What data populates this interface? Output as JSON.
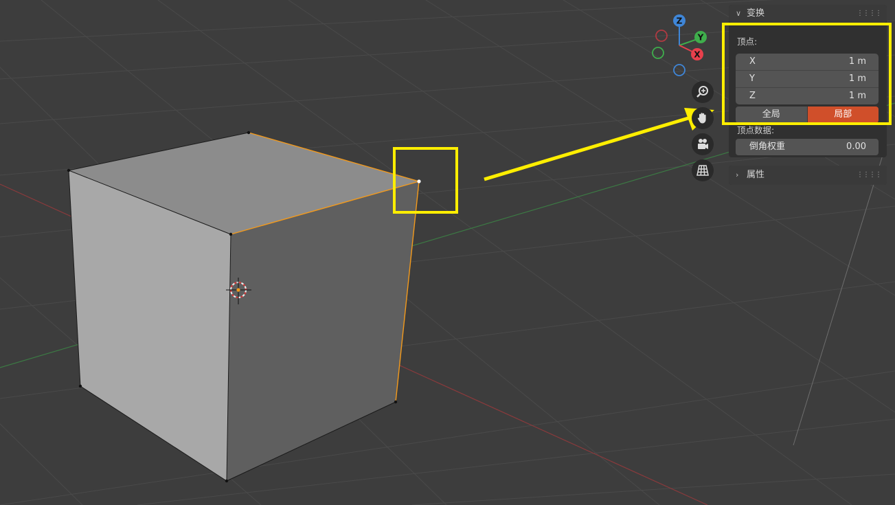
{
  "gizmo": {
    "z": "Z",
    "y": "Y",
    "x": "X"
  },
  "transform_panel": {
    "title": "变换",
    "vertex_label": "顶点:",
    "coords": [
      {
        "axis": "X",
        "value": "1 m"
      },
      {
        "axis": "Y",
        "value": "1 m"
      },
      {
        "axis": "Z",
        "value": "1 m"
      }
    ],
    "global_label": "全局",
    "local_label": "局部",
    "vertex_data_label": "顶点数据:",
    "bevel_label": "倒角权重",
    "bevel_value": "0.00"
  },
  "properties_panel": {
    "title": "属性"
  },
  "colors": {
    "viewport_bg": "#3d3d3d",
    "accent_active": "#d04f2a",
    "highlight": "#ffee00",
    "x_axis": "#e8404c",
    "y_axis": "#3fae4c",
    "z_axis": "#3f86d8",
    "selection": "#f39a1c"
  },
  "icons": {
    "zoom": "zoom-in-icon",
    "pan": "hand-pan-icon",
    "camera": "camera-icon",
    "ortho": "grid-perspective-icon"
  }
}
